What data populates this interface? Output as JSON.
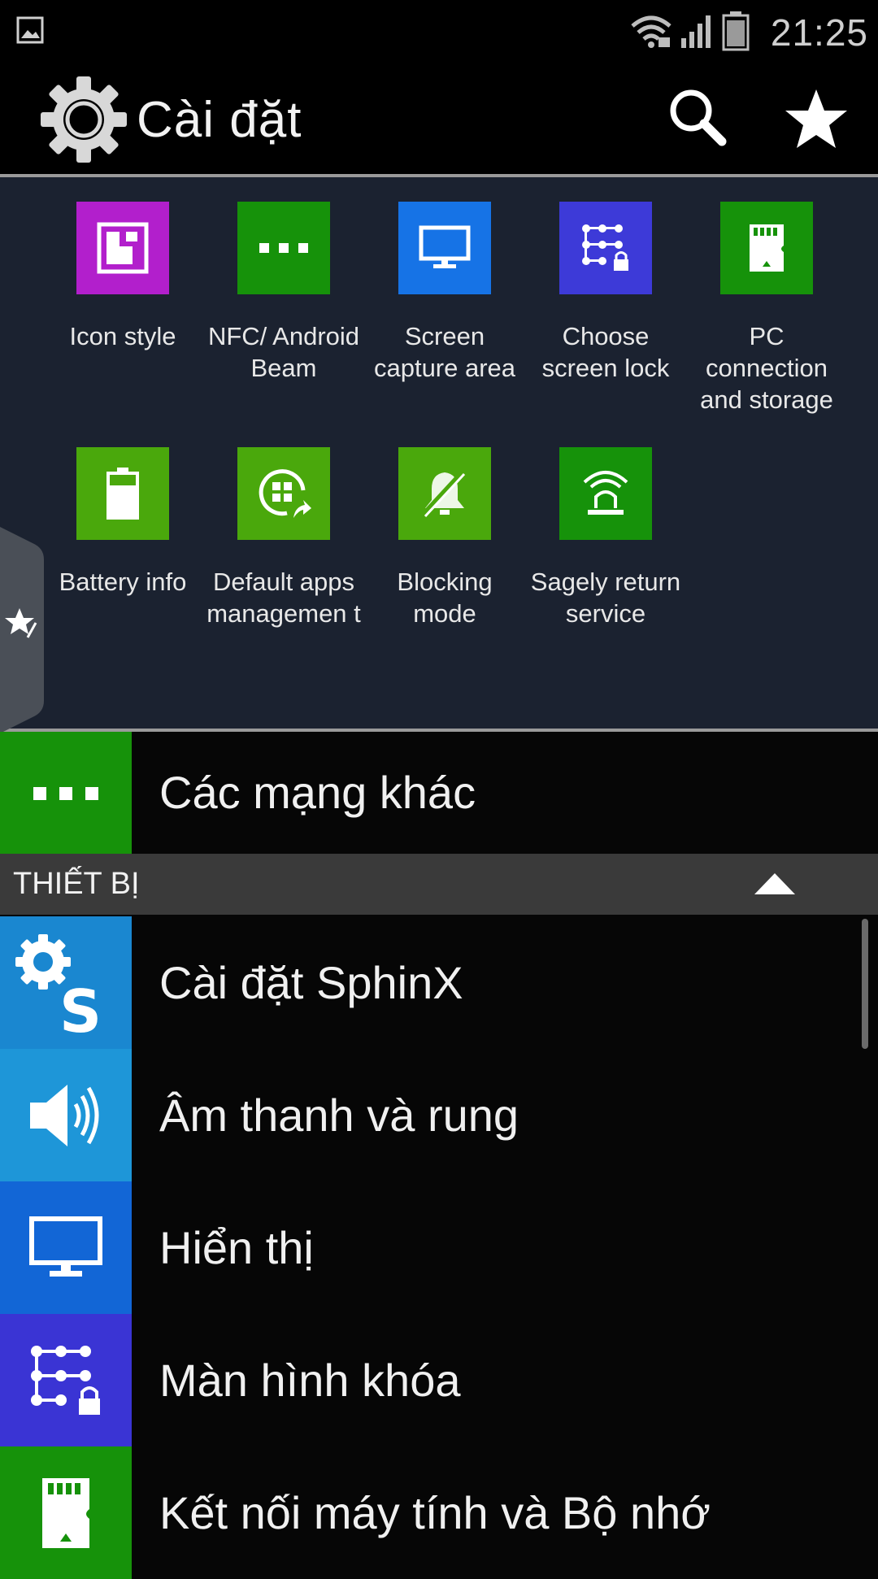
{
  "status_bar": {
    "time": "21:25"
  },
  "action_bar": {
    "title": "Cài đặt"
  },
  "quick_settings": [
    {
      "label": "Icon style",
      "color": "#b21fcc"
    },
    {
      "label": "NFC/ Android Beam",
      "color": "#16920a"
    },
    {
      "label": "Screen capture area",
      "color": "#1673e6"
    },
    {
      "label": "Choose screen lock",
      "color": "#3d3ad8"
    },
    {
      "label": "PC connection and storage",
      "color": "#16920a"
    },
    {
      "label": "Battery info",
      "color": "#4aa80c"
    },
    {
      "label": "Default apps managemen t",
      "color": "#4aa80c"
    },
    {
      "label": "Blocking mode",
      "color": "#4aa80c"
    },
    {
      "label": "Sagely return service",
      "color": "#16920a"
    }
  ],
  "other_networks": {
    "label": "Các mạng khác",
    "color": "#16920a"
  },
  "section": {
    "title": "THIẾT BỊ"
  },
  "device_items": [
    {
      "label": "Cài đặt SphinX",
      "color": "#1a87d0"
    },
    {
      "label": "Âm thanh và rung",
      "color": "#1e96d8"
    },
    {
      "label": "Hiển thị",
      "color": "#1266d6"
    },
    {
      "label": "Màn hình khóa",
      "color": "#3a34d4"
    },
    {
      "label": "Kết nối máy tính và Bộ nhớ",
      "color": "#16920a"
    }
  ]
}
